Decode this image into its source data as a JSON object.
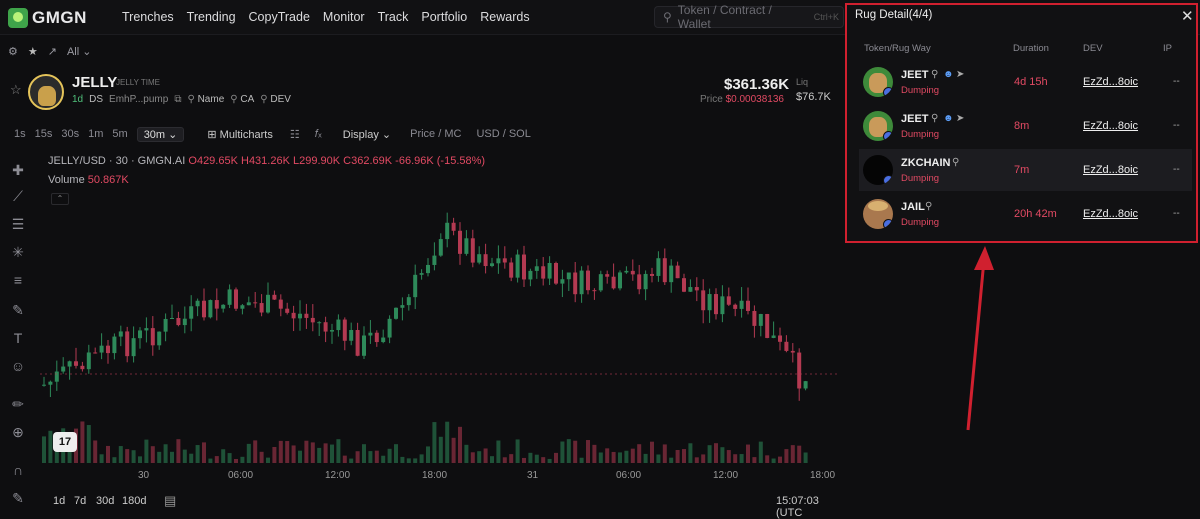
{
  "brand": {
    "name": "GMGN"
  },
  "nav": {
    "links": [
      "Trenches",
      "Trending",
      "CopyTrade",
      "Monitor",
      "Track",
      "Portfolio",
      "Rewards"
    ]
  },
  "search": {
    "placeholder": "Token / Contract / Wallet",
    "shortcut": "Ctrl+K"
  },
  "subbar": {
    "all": "All"
  },
  "token": {
    "symbol": "JELLY",
    "name": "JELLY TIME",
    "age": "1d",
    "ds": "DS",
    "ca": "EmhP...pump",
    "links": [
      "Name",
      "CA",
      "DEV"
    ],
    "price_mc": "$361.36K",
    "price_label": "Price",
    "price": "$0.00038136",
    "liq_label": "Liq",
    "liq": "$76.7K"
  },
  "toolbar": {
    "timeframes": [
      "1s",
      "15s",
      "30s",
      "1m",
      "5m",
      "30m"
    ],
    "active": "30m",
    "multicharts": "Multicharts",
    "display": "Display",
    "price_mc": "Price / MC",
    "usd_sol": "USD / SOL"
  },
  "chart_header": {
    "pair": "JELLY/USD · 30 · GMGN.AI",
    "o": "O429.65K",
    "h": "H431.26K",
    "l": "L299.90K",
    "c": "C362.69K",
    "chg": "-66.96K (-15.58%)",
    "volume_label": "Volume",
    "volume": "50.867K"
  },
  "chart_data": {
    "type": "candlestick",
    "x_labels": [
      "30",
      "06:00",
      "12:00",
      "18:00",
      "31",
      "06:00",
      "12:00",
      "18:00"
    ],
    "last_price_line": true
  },
  "bottombar": {
    "ranges": [
      "1d",
      "7d",
      "30d",
      "180d"
    ],
    "time": "15:07:03 (UTC"
  },
  "rug": {
    "title": "Rug Detail(4/4)",
    "columns": [
      "Token/Rug Way",
      "Duration",
      "DEV",
      "IP"
    ],
    "rows": [
      {
        "name": "JEET",
        "way": "Dumping",
        "duration": "4d 15h",
        "dev": "EzZd...8oic",
        "ip": "--"
      },
      {
        "name": "JEET",
        "way": "Dumping",
        "duration": "8m",
        "dev": "EzZd...8oic",
        "ip": "--"
      },
      {
        "name": "ZKCHAIN",
        "way": "Dumping",
        "duration": "7m",
        "dev": "EzZd...8oic",
        "ip": "--"
      },
      {
        "name": "JAIL",
        "way": "Dumping",
        "duration": "20h 42m",
        "dev": "EzZd...8oic",
        "ip": "--"
      }
    ]
  },
  "colors": {
    "up": "#2e8a5a",
    "down": "#b43a52",
    "accent": "#e24a63",
    "highlight": "#d0202f"
  }
}
